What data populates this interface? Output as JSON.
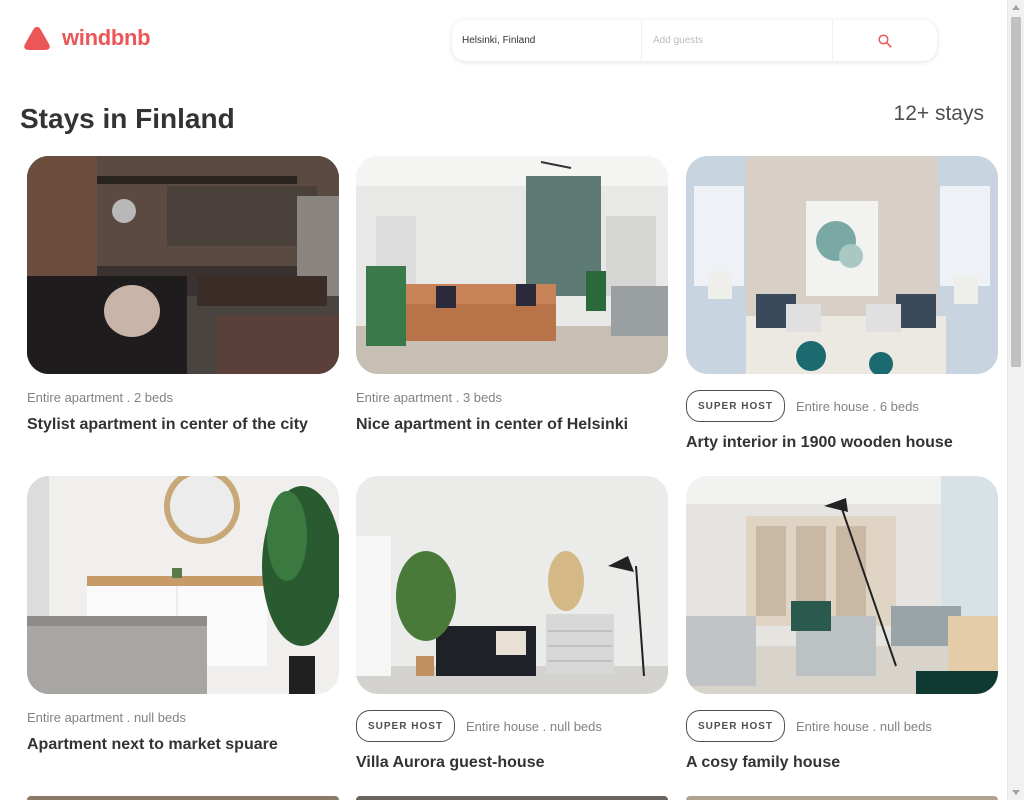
{
  "brand": {
    "name": "windbnb",
    "color": "#eb5757"
  },
  "search": {
    "location": "Helsinki, Finland",
    "guests_placeholder": "Add guests",
    "icon": "search-icon"
  },
  "page": {
    "title": "Stays in Finland",
    "count_label": "12+ stays"
  },
  "stays": [
    {
      "super_host": false,
      "badge": "",
      "kind": "Entire apartment . 2 beds",
      "title": "Stylist apartment in center of the city",
      "image": "loft-living-room-photo"
    },
    {
      "super_host": false,
      "badge": "",
      "kind": "Entire apartment . 3 beds",
      "title": "Nice apartment in center of Helsinki",
      "image": "bright-living-room-photo"
    },
    {
      "super_host": true,
      "badge": "SUPER HOST",
      "kind": "Entire house . 6 beds",
      "title": "Arty interior in 1900 wooden house",
      "image": "sofa-with-painting-photo"
    },
    {
      "super_host": false,
      "badge": "",
      "kind": "Entire apartment . null beds",
      "title": "Apartment next to market spuare",
      "image": "bedroom-with-plant-photo"
    },
    {
      "super_host": true,
      "badge": "SUPER HOST",
      "kind": "Entire house . null beds",
      "title": "Villa Aurora guest-house",
      "image": "minimal-room-photo"
    },
    {
      "super_host": true,
      "badge": "SUPER HOST",
      "kind": "Entire house . null beds",
      "title": "A cosy family house",
      "image": "lounge-chairs-photo"
    }
  ]
}
